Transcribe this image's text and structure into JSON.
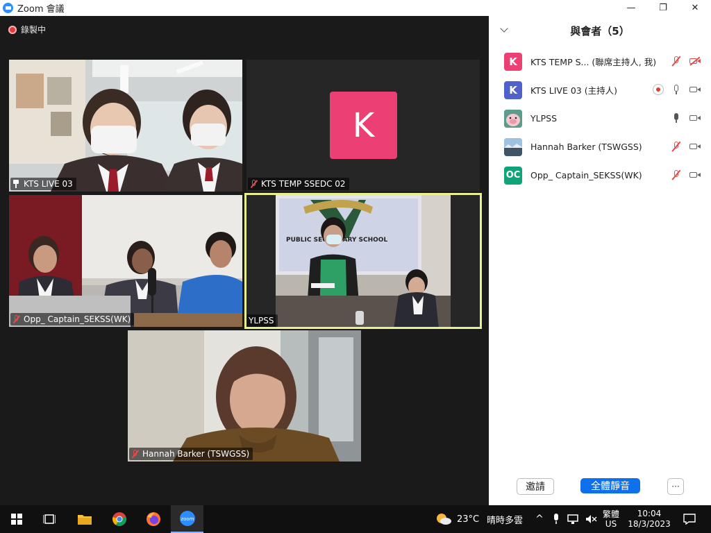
{
  "window": {
    "title": "Zoom 會議",
    "minimize": "—",
    "maximize": "❐",
    "close": "✕"
  },
  "recording": {
    "label": "錄製中"
  },
  "tiles": [
    {
      "name": "KTS LIVE 03",
      "status": "pinned"
    },
    {
      "name": "KTS TEMP SSEDC 02",
      "status": "muted",
      "avatar_letter": "K"
    },
    {
      "name": "Opp_ Captain_SEKSS(WK)",
      "status": "muted"
    },
    {
      "name": "YLPSS",
      "status": "speaking"
    },
    {
      "name": "Hannah Barker (TSWGSS)",
      "status": "muted"
    }
  ],
  "panel": {
    "title": "與會者（5）",
    "participants": [
      {
        "avatar": "K",
        "color": "#ec3f73",
        "name": "KTS TEMP S...  (聯席主持人, 我)",
        "mic": "off",
        "cam": "off"
      },
      {
        "avatar": "K",
        "color": "#5061c9",
        "name": "KTS LIVE 03 (主持人)",
        "mic": "on",
        "cam": "on",
        "recording": true
      },
      {
        "avatar": "pig",
        "color": "#e9e9e9",
        "name": "YLPSS",
        "mic": "active",
        "cam": "on"
      },
      {
        "avatar": "photo",
        "color": "#7aa4c9",
        "name": "Hannah Barker (TSWGSS)",
        "mic": "off",
        "cam": "on"
      },
      {
        "avatar": "OC",
        "color": "#10a37a",
        "name": "Opp_ Captain_SEKSS(WK)",
        "mic": "off",
        "cam": "on"
      }
    ],
    "invite": "邀請",
    "mute_all": "全體靜音",
    "more": "···"
  },
  "taskbar": {
    "weather_temp": "23°C",
    "weather_desc": "晴時多雲",
    "ime_lang": "繁體",
    "ime_layout": "US",
    "time": "10:04",
    "date": "18/3/2023"
  }
}
